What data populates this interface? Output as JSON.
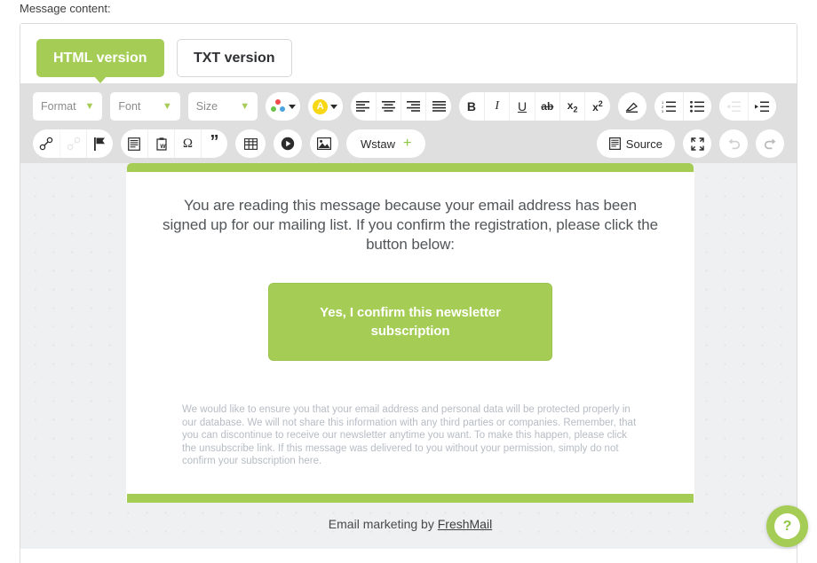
{
  "field_label": "Message content:",
  "tabs": [
    {
      "label": "HTML version",
      "active": true
    },
    {
      "label": "TXT version",
      "active": false
    }
  ],
  "toolbar": {
    "dropdowns": [
      {
        "name": "format",
        "value": "Format"
      },
      {
        "name": "font",
        "value": "Font"
      },
      {
        "name": "size",
        "value": "Size"
      }
    ],
    "source_label": "Source",
    "insert_label": "Wstaw",
    "insert_plus": "+",
    "icons_row1": [
      "background-color-icon",
      "text-color-icon",
      "align-left-icon",
      "align-center-icon",
      "align-right-icon",
      "align-justify-icon",
      "bold-icon",
      "italic-icon",
      "underline-icon",
      "strikethrough-icon",
      "subscript-icon",
      "superscript-icon",
      "remove-format-icon",
      "numbered-list-icon",
      "bulleted-list-icon",
      "outdent-icon",
      "indent-icon"
    ],
    "icons_row2": [
      "link-icon",
      "unlink-icon",
      "anchor-flag-icon",
      "templates-icon",
      "paste-from-word-icon",
      "special-character-icon",
      "blockquote-icon",
      "table-icon",
      "media-icon",
      "image-icon",
      "source-icon",
      "maximize-icon",
      "undo-icon",
      "redo-icon"
    ],
    "bold_glyph": "B",
    "italic_glyph": "I",
    "underline_glyph": "U",
    "strike_glyph": "ab",
    "sub_glyph": "x",
    "sub_index": "2",
    "sup_glyph": "x",
    "sup_index": "2",
    "text_color_glyph": "A"
  },
  "email": {
    "intro": "You are reading this message because your email address has been signed up for our mailing list. If you confirm the registration, please click the button below:",
    "cta_label": "Yes, I confirm this newsletter subscription",
    "legal": "We would like to ensure you that your email address and personal data will be protected properly in our database. We will not share this information with any third parties or companies. Remember, that you can discontinue to receive our newsletter anytime you want. To make this happen, please click the unsubscribe link. If this message was delivered to you without your permission, simply do not confirm your subscription here.",
    "footer_prefix": "Email marketing by ",
    "footer_brand": "FreshMail"
  },
  "help": {
    "glyph": "?"
  },
  "colors": {
    "brand_green": "#a5cd55",
    "toolbar_bg": "#dfdfdf",
    "canvas_bg": "#eff0f2",
    "body_text": "#525659",
    "legal_text": "#b7bcc4"
  }
}
